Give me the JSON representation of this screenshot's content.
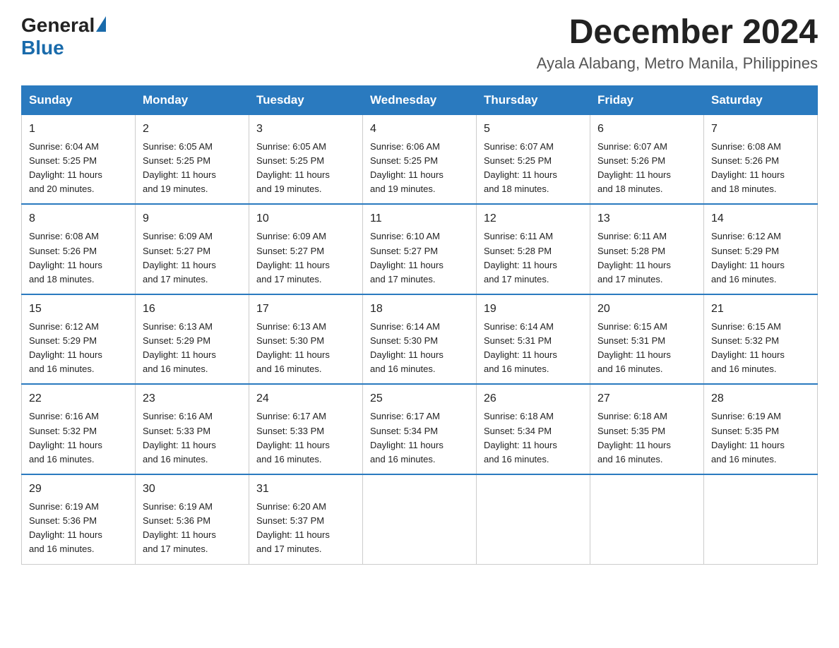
{
  "header": {
    "logo_general": "General",
    "logo_blue": "Blue",
    "month_title": "December 2024",
    "location": "Ayala Alabang, Metro Manila, Philippines"
  },
  "weekdays": [
    "Sunday",
    "Monday",
    "Tuesday",
    "Wednesday",
    "Thursday",
    "Friday",
    "Saturday"
  ],
  "weeks": [
    [
      {
        "day": "1",
        "sunrise": "6:04 AM",
        "sunset": "5:25 PM",
        "daylight": "11 hours and 20 minutes."
      },
      {
        "day": "2",
        "sunrise": "6:05 AM",
        "sunset": "5:25 PM",
        "daylight": "11 hours and 19 minutes."
      },
      {
        "day": "3",
        "sunrise": "6:05 AM",
        "sunset": "5:25 PM",
        "daylight": "11 hours and 19 minutes."
      },
      {
        "day": "4",
        "sunrise": "6:06 AM",
        "sunset": "5:25 PM",
        "daylight": "11 hours and 19 minutes."
      },
      {
        "day": "5",
        "sunrise": "6:07 AM",
        "sunset": "5:25 PM",
        "daylight": "11 hours and 18 minutes."
      },
      {
        "day": "6",
        "sunrise": "6:07 AM",
        "sunset": "5:26 PM",
        "daylight": "11 hours and 18 minutes."
      },
      {
        "day": "7",
        "sunrise": "6:08 AM",
        "sunset": "5:26 PM",
        "daylight": "11 hours and 18 minutes."
      }
    ],
    [
      {
        "day": "8",
        "sunrise": "6:08 AM",
        "sunset": "5:26 PM",
        "daylight": "11 hours and 18 minutes."
      },
      {
        "day": "9",
        "sunrise": "6:09 AM",
        "sunset": "5:27 PM",
        "daylight": "11 hours and 17 minutes."
      },
      {
        "day": "10",
        "sunrise": "6:09 AM",
        "sunset": "5:27 PM",
        "daylight": "11 hours and 17 minutes."
      },
      {
        "day": "11",
        "sunrise": "6:10 AM",
        "sunset": "5:27 PM",
        "daylight": "11 hours and 17 minutes."
      },
      {
        "day": "12",
        "sunrise": "6:11 AM",
        "sunset": "5:28 PM",
        "daylight": "11 hours and 17 minutes."
      },
      {
        "day": "13",
        "sunrise": "6:11 AM",
        "sunset": "5:28 PM",
        "daylight": "11 hours and 17 minutes."
      },
      {
        "day": "14",
        "sunrise": "6:12 AM",
        "sunset": "5:29 PM",
        "daylight": "11 hours and 16 minutes."
      }
    ],
    [
      {
        "day": "15",
        "sunrise": "6:12 AM",
        "sunset": "5:29 PM",
        "daylight": "11 hours and 16 minutes."
      },
      {
        "day": "16",
        "sunrise": "6:13 AM",
        "sunset": "5:29 PM",
        "daylight": "11 hours and 16 minutes."
      },
      {
        "day": "17",
        "sunrise": "6:13 AM",
        "sunset": "5:30 PM",
        "daylight": "11 hours and 16 minutes."
      },
      {
        "day": "18",
        "sunrise": "6:14 AM",
        "sunset": "5:30 PM",
        "daylight": "11 hours and 16 minutes."
      },
      {
        "day": "19",
        "sunrise": "6:14 AM",
        "sunset": "5:31 PM",
        "daylight": "11 hours and 16 minutes."
      },
      {
        "day": "20",
        "sunrise": "6:15 AM",
        "sunset": "5:31 PM",
        "daylight": "11 hours and 16 minutes."
      },
      {
        "day": "21",
        "sunrise": "6:15 AM",
        "sunset": "5:32 PM",
        "daylight": "11 hours and 16 minutes."
      }
    ],
    [
      {
        "day": "22",
        "sunrise": "6:16 AM",
        "sunset": "5:32 PM",
        "daylight": "11 hours and 16 minutes."
      },
      {
        "day": "23",
        "sunrise": "6:16 AM",
        "sunset": "5:33 PM",
        "daylight": "11 hours and 16 minutes."
      },
      {
        "day": "24",
        "sunrise": "6:17 AM",
        "sunset": "5:33 PM",
        "daylight": "11 hours and 16 minutes."
      },
      {
        "day": "25",
        "sunrise": "6:17 AM",
        "sunset": "5:34 PM",
        "daylight": "11 hours and 16 minutes."
      },
      {
        "day": "26",
        "sunrise": "6:18 AM",
        "sunset": "5:34 PM",
        "daylight": "11 hours and 16 minutes."
      },
      {
        "day": "27",
        "sunrise": "6:18 AM",
        "sunset": "5:35 PM",
        "daylight": "11 hours and 16 minutes."
      },
      {
        "day": "28",
        "sunrise": "6:19 AM",
        "sunset": "5:35 PM",
        "daylight": "11 hours and 16 minutes."
      }
    ],
    [
      {
        "day": "29",
        "sunrise": "6:19 AM",
        "sunset": "5:36 PM",
        "daylight": "11 hours and 16 minutes."
      },
      {
        "day": "30",
        "sunrise": "6:19 AM",
        "sunset": "5:36 PM",
        "daylight": "11 hours and 17 minutes."
      },
      {
        "day": "31",
        "sunrise": "6:20 AM",
        "sunset": "5:37 PM",
        "daylight": "11 hours and 17 minutes."
      },
      null,
      null,
      null,
      null
    ]
  ],
  "labels": {
    "sunrise": "Sunrise:",
    "sunset": "Sunset:",
    "daylight": "Daylight:"
  }
}
